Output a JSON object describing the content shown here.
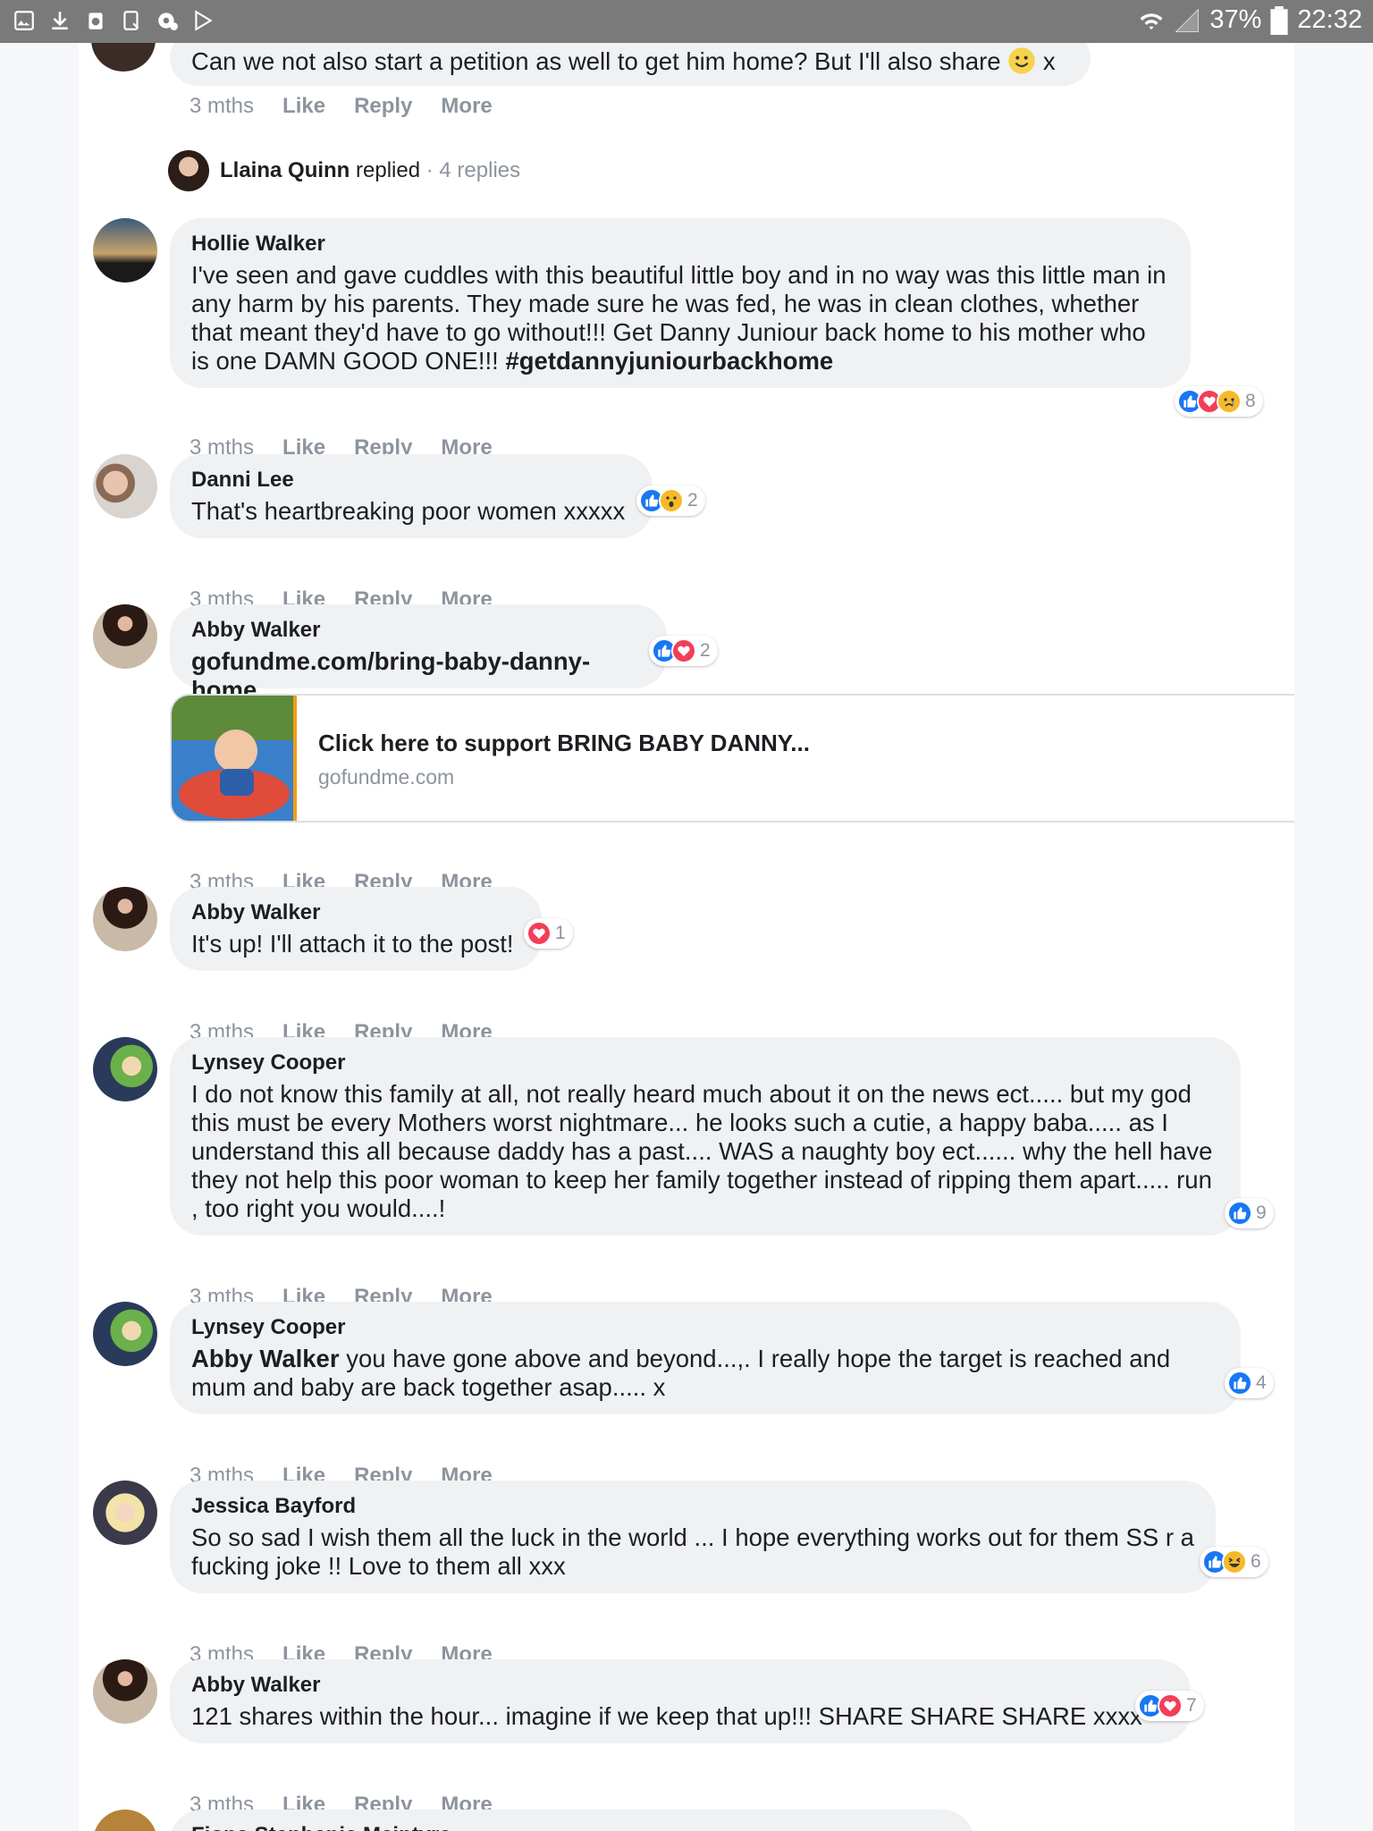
{
  "status_bar": {
    "battery_percent": "37%",
    "time": "22:32",
    "left_icons": [
      "gallery-icon",
      "download-icon",
      "recycle-icon",
      "tablet-icon",
      "settings-icon",
      "play-store-icon"
    ]
  },
  "partial_comment": {
    "text": "Can we not also start a petition as well to get him home? But I'll also share",
    "suffix": "x",
    "time": "3 mths"
  },
  "replies_summary": {
    "name": "Llaina Quinn",
    "action": "replied",
    "count": "4 replies"
  },
  "actions": {
    "like": "Like",
    "reply": "Reply",
    "more": "More"
  },
  "comments": [
    {
      "author": "Hollie Walker",
      "text": "I've seen and gave cuddles with this beautiful little boy and in no way was this little man in any harm by his parents. They made sure he was fed, he was in clean clothes, whether that meant they'd have to go without!!! Get Danny Juniour back home to his mother who is one DAMN GOOD ONE!!!",
      "hashtag": "#getdannyjuniourbackhome",
      "time": "3 mths",
      "reactions": [
        "like",
        "love",
        "sad"
      ],
      "reaction_count": "8"
    },
    {
      "author": "Danni Lee",
      "text": "That's heartbreaking poor women xxxxx",
      "time": "3 mths",
      "reactions": [
        "like",
        "wow"
      ],
      "reaction_count": "2"
    },
    {
      "author": "Abby Walker",
      "text": "gofundme.com/bring-baby-danny-home",
      "time": "3 mths",
      "reactions": [
        "like",
        "love"
      ],
      "reaction_count": "2",
      "link_card": {
        "title": "Click here to support BRING BABY DANNY...",
        "domain": "gofundme.com"
      }
    },
    {
      "author": "Abby Walker",
      "text": "It's up! I'll attach it to the post!",
      "time": "3 mths",
      "reactions": [
        "love"
      ],
      "reaction_count": "1"
    },
    {
      "author": "Lynsey Cooper",
      "text": "I do not know this family at all, not really heard much about it on the news ect..... but my god this must be every Mothers worst nightmare... he looks such a cutie, a happy baba..... as I understand this all because daddy has a past.... WAS a naughty boy ect...... why the hell have they not help this poor woman to keep her family together instead of ripping them apart..... run , too right you would....!",
      "time": "3 mths",
      "reactions": [
        "like"
      ],
      "reaction_count": "9"
    },
    {
      "author": "Lynsey Cooper",
      "mention": "Abby Walker",
      "text": "you have gone above and beyond...,. I really hope the target is reached and mum and baby are back together asap..... x",
      "time": "3 mths",
      "reactions": [
        "like"
      ],
      "reaction_count": "4"
    },
    {
      "author": "Jessica Bayford",
      "text": "So so sad I wish them all the luck in the world ... I hope everything works out for them SS r a fucking joke !! Love to them all xxx",
      "time": "3 mths",
      "reactions": [
        "like",
        "haha"
      ],
      "reaction_count": "6"
    },
    {
      "author": "Abby Walker",
      "text": "121 shares within the hour... imagine if we keep that up!!! SHARE SHARE SHARE xxxx",
      "time": "3 mths",
      "reactions": [
        "like",
        "love"
      ],
      "reaction_count": "7"
    },
    {
      "author": "Fiona Stephanie Mcintyre"
    }
  ],
  "colors": {
    "like_blue": "#1877f2",
    "love_red": "#f33e58",
    "emoji_yellow": "#f7b928",
    "bubble_gray": "#eff1f3",
    "meta_gray": "#8d949e"
  }
}
